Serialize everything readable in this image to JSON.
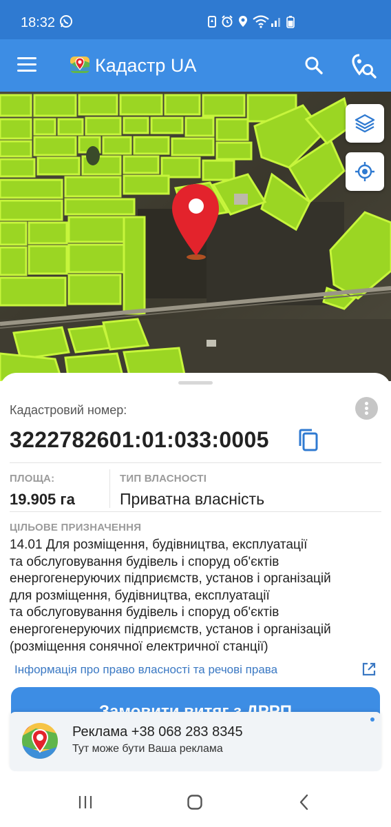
{
  "status_bar": {
    "time": "18:32"
  },
  "app_bar": {
    "title": "Кадастр UA"
  },
  "parcel": {
    "cadastral_label": "Кадастровий номер:",
    "cadastral_number": "3222782601:01:033:0005",
    "area_caption": "ПЛОЩА:",
    "area_value": "19.905 га",
    "ownership_caption": "ТИП ВЛАСНОСТІ",
    "ownership_value": "Приватна власність",
    "purpose_caption": "ЦІЛЬОВЕ ПРИЗНАЧЕННЯ",
    "purpose_text": "14.01 Для розміщення, будівництва, експлуатації\nта обслуговування будівель і споруд об'єктів\nенергогенеруючих підприємств, установ і організацій\nдля розміщення, будівництва, експлуатації\nта обслуговування будівель і споруд об'єктів\nенергогенеруючих підприємств, установ і організацій\n(розміщення сонячної електричної станції)",
    "rights_link": "Інформація про право власності та речові права",
    "order_button": "Замовити витяг з ДРРП"
  },
  "ad": {
    "title": "Реклама  +38 068 283 8345",
    "subtitle": "Тут може бути Ваша реклама"
  },
  "colors": {
    "status_bar": "#2f7ad1",
    "app_bar": "#3d8de4",
    "parcel_fill": "#a4e01c",
    "pin": "#e3232c",
    "link": "#3a78c3"
  },
  "icons": [
    "whatsapp-icon",
    "battery-saver-icon",
    "alarm-icon",
    "location-icon",
    "wifi-icon",
    "signal-icon",
    "battery-icon",
    "menu-icon",
    "app-logo-icon",
    "search-icon",
    "pin-search-icon",
    "layers-icon",
    "my-location-icon",
    "map-pin-icon",
    "more-vert-icon",
    "copy-icon",
    "external-link-icon",
    "recent-apps-icon",
    "home-icon",
    "back-icon"
  ]
}
